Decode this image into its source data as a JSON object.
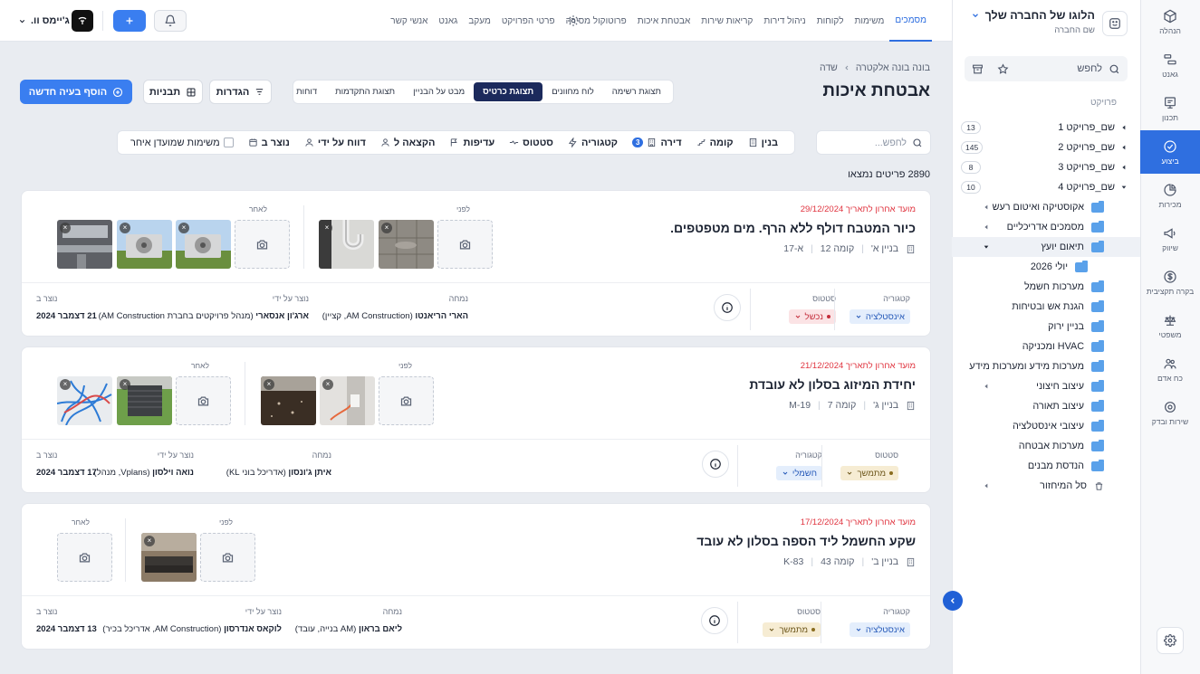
{
  "rail": {
    "items": [
      {
        "label": "הנהלה",
        "icon": "cube-icon",
        "active": false
      },
      {
        "label": "גאנט",
        "icon": "gantt-icon",
        "active": false
      },
      {
        "label": "תכנון",
        "icon": "plan-icon",
        "active": false
      },
      {
        "label": "ביצוע",
        "icon": "check-circle-icon",
        "active": true
      },
      {
        "label": "מכירות",
        "icon": "pie-icon",
        "active": false
      },
      {
        "label": "שיווק",
        "icon": "megaphone-icon",
        "active": false
      },
      {
        "label": "בקרה תקציבית",
        "icon": "dollar-icon",
        "active": false
      },
      {
        "label": "משפטי",
        "icon": "scales-icon",
        "active": false
      },
      {
        "label": "כח אדם",
        "icon": "people-icon",
        "active": false
      },
      {
        "label": "שירות ובדק",
        "icon": "service-icon",
        "active": false
      }
    ]
  },
  "company": {
    "title": "הלוגו של החברה שלך",
    "subtitle": "שם החברה"
  },
  "sidebar": {
    "search_placeholder": "לחפש",
    "section_label": "פרויקט",
    "projects": [
      {
        "name": "שם_פרויקט 1",
        "count": "13"
      },
      {
        "name": "שם_פרויקט 2",
        "count": "145"
      },
      {
        "name": "שם_פרויקט 3",
        "count": "8"
      },
      {
        "name": "שם_פרויקט 4",
        "count": "10"
      }
    ],
    "folders": [
      {
        "name": "אקוסטיקה ואיטום רעש"
      },
      {
        "name": "מסמכים אדריכליים"
      },
      {
        "name": "תיאום יועץ"
      },
      {
        "name": "יולי 2026"
      },
      {
        "name": "מערכות חשמל"
      },
      {
        "name": "הגנת אש ובטיחות"
      },
      {
        "name": "בניין ירוק"
      },
      {
        "name": "HVAC ומכניקה"
      },
      {
        "name": "מערכות מידע ומערכות מידע"
      },
      {
        "name": "עיצוב חיצוני"
      },
      {
        "name": "עיצוב תאורה"
      },
      {
        "name": "עיצובי אינסטלציה"
      },
      {
        "name": "מערכות אבטחה"
      },
      {
        "name": "הנדסת מבנים"
      },
      {
        "name": "סל המיחזור"
      }
    ]
  },
  "topnav": {
    "tabs": [
      "מסמכים",
      "משימות",
      "לקוחות",
      "ניהול דירות",
      "קריאות שירות",
      "אבטחת איכות",
      "פרוטוקול מסירה",
      "פרטי הפרויקט",
      "מעקב",
      "גאנט",
      "אנשי קשר"
    ],
    "active": "מסמכים",
    "user": "ג'יימס וו."
  },
  "page": {
    "breadcrumb": [
      "בונה בונה אלקטרה",
      "שדה"
    ],
    "title": "אבטחת איכות",
    "view_tabs": [
      "תצוגת רשימה",
      "לוח מחוונים",
      "תצוגת כרטיס",
      "מבט על הבניין",
      "תצוגת התקדמות",
      "דוחות"
    ],
    "active_view": "תצוגת כרטיס",
    "settings_btn": "הגדרות",
    "templates_btn": "תבניות",
    "add_btn": "הוסף בעיה חדשה",
    "search_placeholder": "לחפש...",
    "filters": [
      {
        "label": "בנין"
      },
      {
        "label": "קומה"
      },
      {
        "label": "דירה",
        "badge": "3"
      },
      {
        "label": "קטגוריה"
      },
      {
        "label": "סטטוס"
      },
      {
        "label": "עדיפות"
      },
      {
        "label": "הקצאה ל"
      },
      {
        "label": "דווח על ידי"
      },
      {
        "label": "נוצר ב"
      },
      {
        "label": "משימות שמועדן איחר"
      }
    ],
    "results": "2890 פריטים נמצאו"
  },
  "labels": {
    "before": "לפני",
    "after": "לאחר",
    "category": "קטגוריה",
    "status": "סטטוס",
    "expert": "נמחה",
    "created_by": "נוצר על ידי",
    "created_at": "נוצר ב"
  },
  "cards": [
    {
      "due": "מועד אחרון לתאריך 29/12/2024",
      "title": "כיור המטבח דולף ללא הרף. מים מטפטפים.",
      "building": "בניין א'",
      "floor": "קומה 12",
      "unit": "א-17",
      "category": "אינסטלציה",
      "status": "נכשל",
      "assignee_name": "הארי הריאנטו",
      "assignee_role": "(AM Construction, קציין)",
      "creator_name": "ארג'ון אנסארי",
      "creator_role": "(מנהל פרויקטים בחברת AM Construction)",
      "date": "21 דצמבר 2024"
    },
    {
      "due": "מועד אחרון לתאריך 21/12/2024",
      "title": "יחידת המיזוג בסלון לא עובדת",
      "building": "בניין ג'",
      "floor": "קומה 7",
      "unit": "M-19",
      "category": "חשמלי",
      "status": "מתמשך",
      "assignee_name": "איתן ג'ונסון",
      "assignee_role": "(אדריכל בוני KL)",
      "creator_name": "נואה וילסון",
      "creator_role": "(Vplans, מנהל)",
      "date": "17 דצמבר 2024"
    },
    {
      "due": "מועד אחרון לתאריך 17/12/2024",
      "title": "שקע החשמל ליד הספה בסלון לא עובד",
      "building": "בניין ב'",
      "floor": "קומה 43",
      "unit": "K-83",
      "category": "אינסטלציה",
      "status": "מתמשך",
      "assignee_name": "ליאם בראון",
      "assignee_role": "(AM בנייה, עובד)",
      "creator_name": "לוקאס אנדרסון",
      "creator_role": "(AM Construction, אדריכל בכיר)",
      "date": "13 דצמבר 2024"
    }
  ]
}
